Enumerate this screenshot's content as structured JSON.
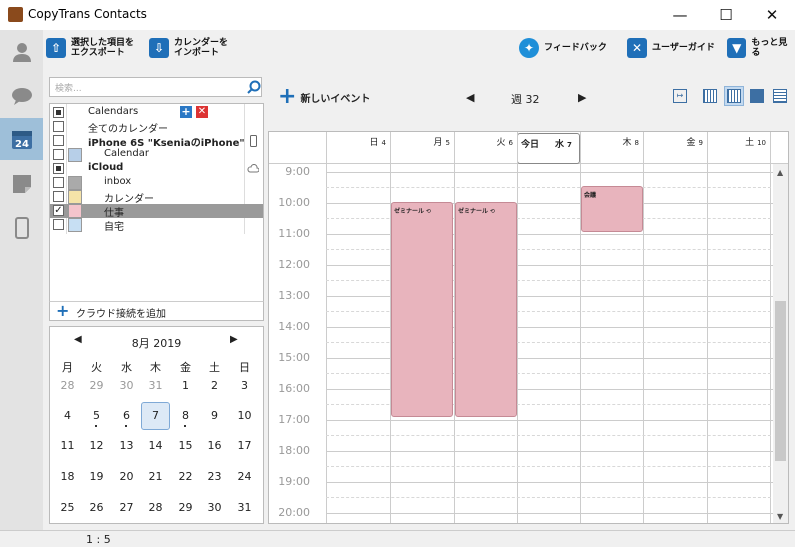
{
  "window": {
    "title": "CopyTrans Contacts"
  },
  "toolbar": {
    "export": [
      "選択した項目を",
      "エクスポート"
    ],
    "import": [
      "カレンダーを",
      "インポート"
    ],
    "feedback": "フィードバック",
    "guide": "ユーザーガイド",
    "more": "もっと見る"
  },
  "search": {
    "placeholder": "検索..."
  },
  "calendars": {
    "header": "Calendars",
    "all": "全てのカレンダー",
    "device": "iPhone 6S \"KseniaのiPhone\"",
    "device_cal": "Calendar",
    "icloud": "iCloud",
    "items": [
      {
        "label": "inbox",
        "color": "#aaaaaa"
      },
      {
        "label": "カレンダー",
        "color": "#f5e3a8"
      },
      {
        "label": "仕事",
        "color": "#f4c4cc"
      },
      {
        "label": "自宅",
        "color": "#c7dff3"
      }
    ],
    "add_cloud": "クラウド接続を追加"
  },
  "mini_cal": {
    "month": "8月 2019",
    "weekdays": [
      "月",
      "火",
      "水",
      "木",
      "金",
      "土"
    ],
    "sun_col": "日",
    "rows": [
      [
        "28",
        "29",
        "30",
        "31",
        "1",
        "2",
        "3"
      ],
      [
        "4",
        "5",
        "6",
        "7",
        "8",
        "9",
        "10"
      ],
      [
        "11",
        "12",
        "13",
        "14",
        "15",
        "16",
        "17"
      ],
      [
        "18",
        "19",
        "20",
        "21",
        "22",
        "23",
        "24"
      ],
      [
        "25",
        "26",
        "27",
        "28",
        "29",
        "30",
        "31"
      ]
    ]
  },
  "week": {
    "new_event": "新しいイベント",
    "label": "週 32",
    "today": "今日",
    "days": [
      {
        "name": "日",
        "num": "4"
      },
      {
        "name": "月",
        "num": "5"
      },
      {
        "name": "火",
        "num": "6"
      },
      {
        "name": "水",
        "num": "7"
      },
      {
        "name": "木",
        "num": "8"
      },
      {
        "name": "金",
        "num": "9"
      },
      {
        "name": "土",
        "num": "10"
      }
    ],
    "hours": [
      "9:00",
      "10:00",
      "11:00",
      "12:00",
      "13:00",
      "14:00",
      "15:00",
      "16:00",
      "17:00",
      "18:00",
      "19:00",
      "20:00"
    ],
    "events": [
      {
        "title": "ゼミナール"
      },
      {
        "title": "ゼミナール"
      },
      {
        "title": "会議"
      }
    ]
  },
  "status": {
    "text": "1 : 5"
  }
}
